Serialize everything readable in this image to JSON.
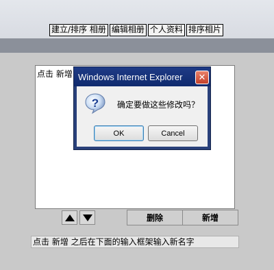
{
  "nav": {
    "items": [
      "建立/排序 相册",
      "编辑相册",
      "个人资料",
      "排序相片"
    ]
  },
  "list": {
    "items": [
      "点击 新增"
    ]
  },
  "buttons": {
    "delete_label": "删除",
    "add_label": "新增"
  },
  "hint_text": "点击 新增 之后在下面的输入框架输入新名字",
  "dialog": {
    "title": "Windows Internet Explorer",
    "message": "确定要做这些修改吗？",
    "ok_label": "OK",
    "cancel_label": "Cancel",
    "icon": "question-icon",
    "close_icon": "close-icon"
  },
  "icons": {
    "up": "arrow-up-icon",
    "down": "arrow-down-icon"
  }
}
